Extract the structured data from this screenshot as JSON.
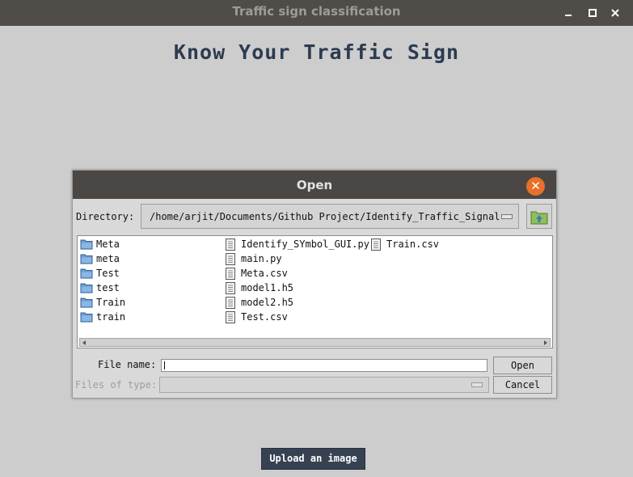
{
  "window": {
    "title": "Traffic sign classification",
    "controls": [
      "minimize-icon",
      "maximize-icon",
      "close-icon"
    ]
  },
  "main": {
    "heading": "Know Your Traffic Sign",
    "upload_button": "Upload an image"
  },
  "dialog": {
    "title": "Open",
    "directory_label": "Directory:",
    "directory_value": "/home/arjit/Documents/Github Project/Identify_Traffic_Signal",
    "files": {
      "col1": [
        {
          "name": "Meta",
          "type": "folder"
        },
        {
          "name": "meta",
          "type": "folder"
        },
        {
          "name": "Test",
          "type": "folder"
        },
        {
          "name": "test",
          "type": "folder"
        },
        {
          "name": "Train",
          "type": "folder"
        },
        {
          "name": "train",
          "type": "folder"
        }
      ],
      "col2": [
        {
          "name": "Identify_SYmbol_GUI.py",
          "type": "file"
        },
        {
          "name": "main.py",
          "type": "file"
        },
        {
          "name": "Meta.csv",
          "type": "file"
        },
        {
          "name": "model1.h5",
          "type": "file"
        },
        {
          "name": "model2.h5",
          "type": "file"
        },
        {
          "name": "Test.csv",
          "type": "file"
        }
      ],
      "col3": [
        {
          "name": "Train.csv",
          "type": "file"
        }
      ]
    },
    "file_name_label": "File name:",
    "file_name_value": "",
    "files_of_type_label": "Files of type:",
    "open_button": "Open",
    "cancel_button": "Cancel"
  },
  "colors": {
    "titlebar": "#504d49",
    "accent_close": "#e8702a",
    "heading": "#2c3b4f",
    "upload_button": "#364152"
  }
}
